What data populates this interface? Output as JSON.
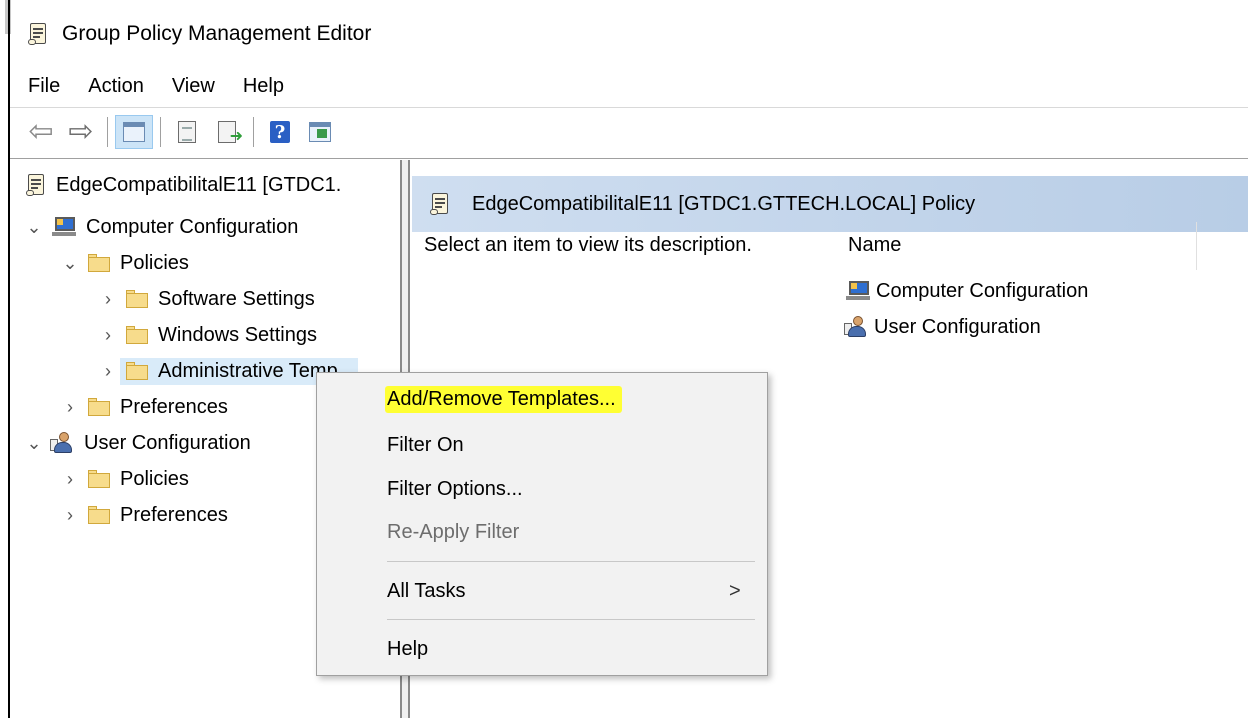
{
  "window": {
    "title": "Group Policy Management Editor"
  },
  "menubar": {
    "items": [
      "File",
      "Action",
      "View",
      "Help"
    ]
  },
  "tree": {
    "root": "EdgeCompatibilitalE11 [GTDC1.",
    "computer_config": "Computer Configuration",
    "cc_policies": "Policies",
    "software_settings": "Software Settings",
    "windows_settings": "Windows Settings",
    "admin_templates": "Administrative Temp",
    "cc_preferences": "Preferences",
    "user_config": "User Configuration",
    "uc_policies": "Policies",
    "uc_preferences": "Preferences"
  },
  "right_pane": {
    "header": "EdgeCompatibilitalE11 [GTDC1.GTTECH.LOCAL] Policy",
    "description": "Select an item to view its description.",
    "column_name": "Name",
    "items": [
      "Computer Configuration",
      "User Configuration"
    ]
  },
  "context_menu": {
    "items": [
      "Add/Remove Templates...",
      "Filter On",
      "Filter Options...",
      "Re-Apply Filter",
      "All Tasks",
      "Help"
    ],
    "submenu_arrow": ">"
  },
  "colors": {
    "highlight": "#ffff33",
    "selection": "#d9ebf9",
    "header_gradient": "#b8cde6"
  }
}
